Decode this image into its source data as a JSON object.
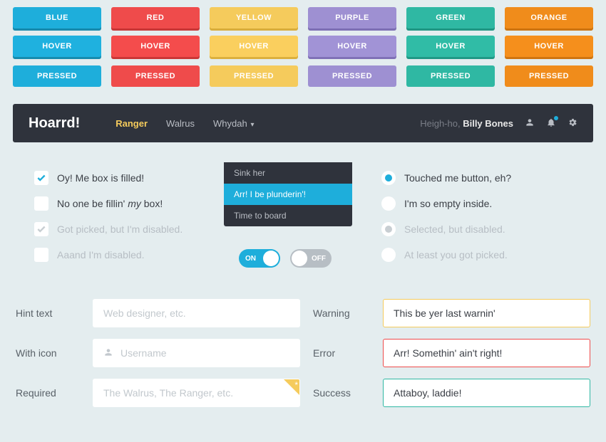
{
  "buttons": {
    "colors": [
      "BLUE",
      "RED",
      "YELLOW",
      "PURPLE",
      "GREEN",
      "ORANGE"
    ],
    "hover": "HOVER",
    "pressed": "PRESSED"
  },
  "navbar": {
    "brand": "Hoarrd!",
    "links": [
      {
        "label": "Ranger",
        "active": true
      },
      {
        "label": "Walrus"
      },
      {
        "label": "Whydah",
        "dropdown": true
      }
    ],
    "greeting_prefix": "Heigh-ho, ",
    "greeting_name": "Billy Bones"
  },
  "dropdown": [
    {
      "label": "Sink her"
    },
    {
      "label": "Arr! I be plunderin'!",
      "selected": true
    },
    {
      "label": "Time to board"
    }
  ],
  "checkboxes": [
    {
      "label": "Oy! Me box is filled!",
      "checked": true
    },
    {
      "label_pre": "No one be fillin' ",
      "label_em": "my",
      "label_post": " box!"
    },
    {
      "label": "Got picked, but I'm disabled.",
      "checked": true,
      "disabled": true
    },
    {
      "label": "Aaand I'm disabled.",
      "disabled": true
    }
  ],
  "radios": [
    {
      "label": "Touched me button, eh?",
      "selected": true
    },
    {
      "label": "I'm so empty inside."
    },
    {
      "label": "Selected, but disabled.",
      "selected": true,
      "disabled": true
    },
    {
      "label": "At least you got picked.",
      "disabled": true
    }
  ],
  "toggles": {
    "on": "ON",
    "off": "OFF"
  },
  "fields": {
    "hint_label": "Hint text",
    "hint_ph": "Web designer, etc.",
    "icon_label": "With icon",
    "icon_ph": "Username",
    "req_label": "Required",
    "req_ph": "The Walrus, The Ranger, etc.",
    "warn_label": "Warning",
    "warn_val": "This be yer last warnin'",
    "err_label": "Error",
    "err_val": "Arr! Somethin' ain't right!",
    "succ_label": "Success",
    "succ_val": "Attaboy, laddie!"
  }
}
